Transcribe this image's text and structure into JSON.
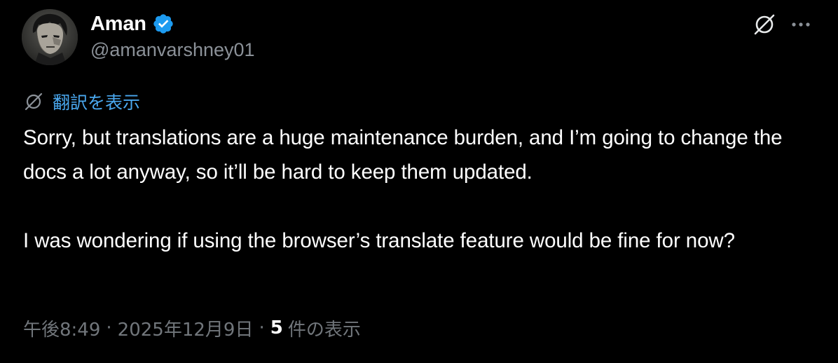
{
  "author": {
    "name": "Aman",
    "handle": "@amanvarshney01",
    "verified": true,
    "avatar": "avatar-anime-character"
  },
  "header_actions": {
    "grok_icon": "grok-slash-circle-icon",
    "more_icon": "more-horizontal-icon"
  },
  "translate": {
    "icon": "grok-slash-circle-icon",
    "label": "翻訳を表示"
  },
  "tweet": {
    "paragraphs": [
      "Sorry, but translations are a huge maintenance burden, and I’m going to change the docs a lot anyway, so it’ll be hard to keep them updated.",
      "I was wondering if using the browser’s translate feature would be fine for now?"
    ]
  },
  "meta": {
    "time": "午後8:49",
    "separator": "·",
    "date": "2025年12月9日",
    "views_count": "5",
    "views_label": "件の表示"
  },
  "colors": {
    "background": "#000000",
    "text": "#ffffff",
    "secondary": "#71767b",
    "link": "#4aa8ef",
    "verified": "#1d9bf0"
  }
}
